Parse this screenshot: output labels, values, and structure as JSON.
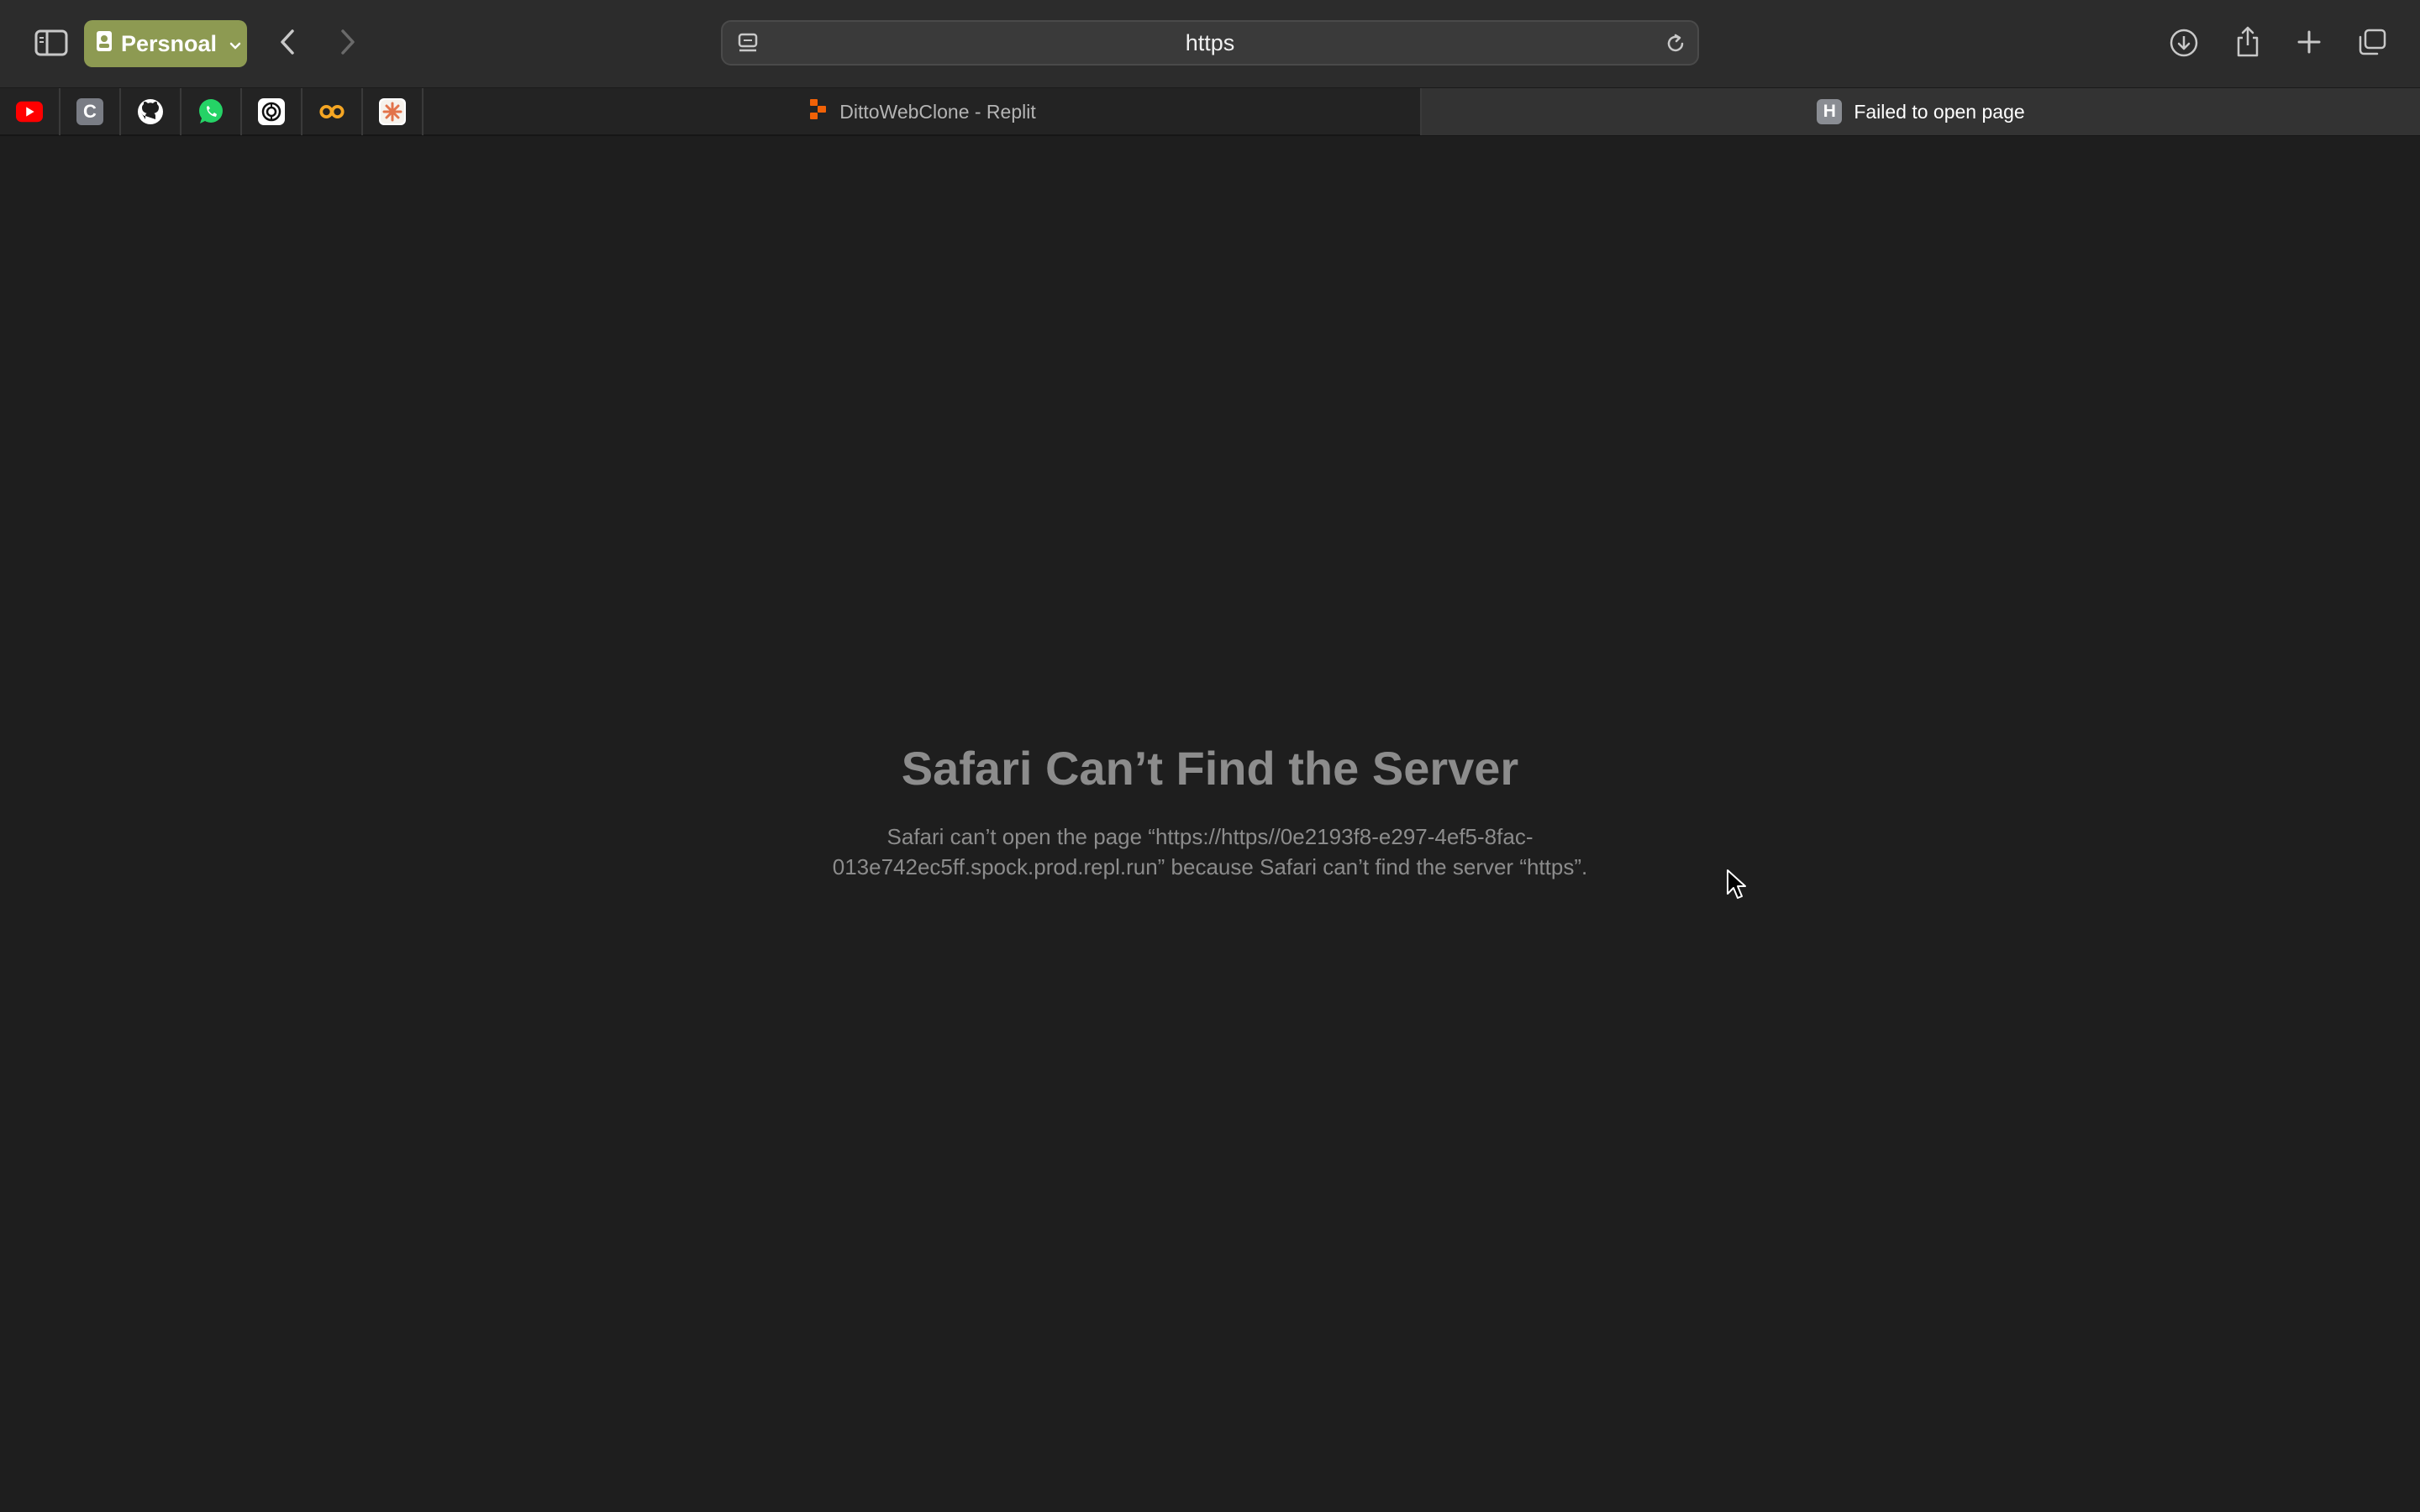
{
  "toolbar": {
    "profile_label": "Persnoal",
    "address_text": "https",
    "accent_color": "#8d9a52"
  },
  "tabs": {
    "pinned": [
      {
        "name": "youtube-icon",
        "color": "#ff0000"
      },
      {
        "name": "c-icon",
        "letter": "C",
        "color": "#7a7d85"
      },
      {
        "name": "github-icon",
        "color": "#ffffff"
      },
      {
        "name": "whatsapp-icon",
        "color": "#25d366"
      },
      {
        "name": "openai-icon",
        "color": "#ffffff"
      },
      {
        "name": "infinity-icon",
        "color": "#f5a623"
      },
      {
        "name": "claude-icon",
        "color": "#e2734a"
      }
    ],
    "inactive_tab_label": "DittoWebClone - Replit",
    "active_tab_label": "Failed to open page",
    "active_tab_favicon_letter": "H"
  },
  "error": {
    "title": "Safari Can’t Find the Server",
    "body": "Safari can’t open the page “https://https//0e2193f8-e297-4ef5-8fac-013e742ec5ff.spock.prod.repl.run” because Safari can’t find the server “https”."
  }
}
